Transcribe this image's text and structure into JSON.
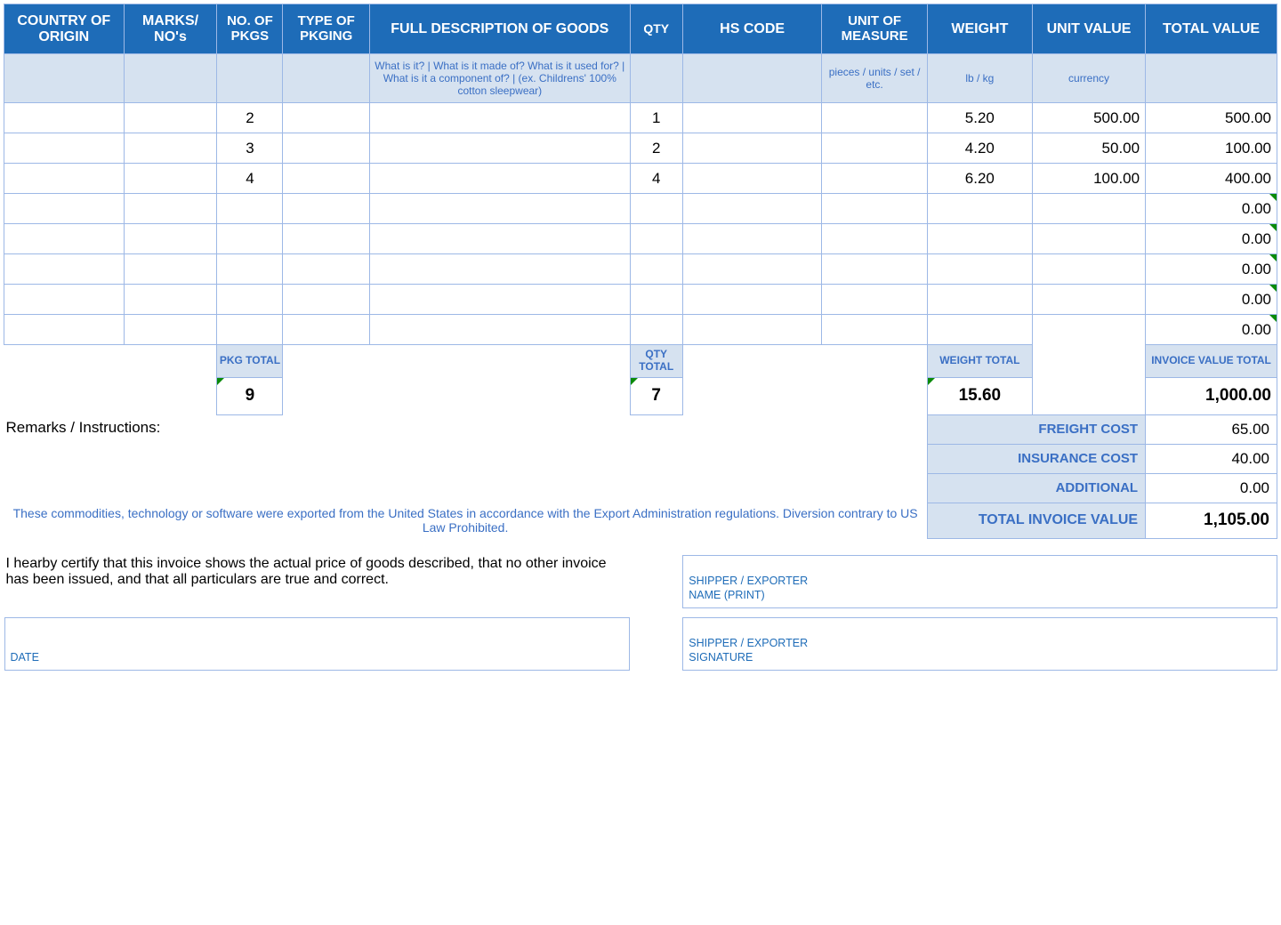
{
  "headers": {
    "country": "COUNTRY OF ORIGIN",
    "marks": "MARKS/ NO's",
    "pkgs": "NO. OF PKGS",
    "pkging": "TYPE OF PKGING",
    "desc": "FULL DESCRIPTION OF GOODS",
    "qty": "QTY",
    "hs": "HS CODE",
    "uom": "UNIT OF MEASURE",
    "weight": "WEIGHT",
    "unitval": "UNIT VALUE",
    "totval": "TOTAL VALUE"
  },
  "hints": {
    "desc": "What is it? | What is it made of? What is it used for? | What is it a component of? | (ex. Childrens' 100% cotton sleepwear)",
    "uom": "pieces / units / set / etc.",
    "weight": "lb / kg",
    "unitval": "currency"
  },
  "rows": [
    {
      "pkgs": "2",
      "qty": "1",
      "weight": "5.20",
      "unitval": "500.00",
      "totval": "500.00"
    },
    {
      "pkgs": "3",
      "qty": "2",
      "weight": "4.20",
      "unitval": "50.00",
      "totval": "100.00"
    },
    {
      "pkgs": "4",
      "qty": "4",
      "weight": "6.20",
      "unitval": "100.00",
      "totval": "400.00"
    },
    {
      "totval": "0.00"
    },
    {
      "totval": "0.00"
    },
    {
      "totval": "0.00"
    },
    {
      "totval": "0.00"
    },
    {
      "totval": "0.00"
    }
  ],
  "totals_labels": {
    "pkg": "PKG TOTAL",
    "qty": "QTY TOTAL",
    "weight": "WEIGHT TOTAL",
    "invoice": "INVOICE VALUE TOTAL"
  },
  "totals": {
    "pkg": "9",
    "qty": "7",
    "weight": "15.60",
    "invoice": "1,000.00"
  },
  "remarks_label": "Remarks / Instructions:",
  "costs": {
    "freight_label": "FREIGHT COST",
    "freight": "65.00",
    "insurance_label": "INSURANCE COST",
    "insurance": "40.00",
    "additional_label": "ADDITIONAL",
    "additional": "0.00",
    "total_label": "TOTAL INVOICE VALUE",
    "total": "1,105.00"
  },
  "footnote": "These commodities, technology or software were exported from the United States in accordance with the Export Administration regulations.  Diversion contrary to US Law Prohibited.",
  "cert": "I hearby certify that this invoice shows the actual price of goods described, that no other invoice has been issued, and that all particulars are true and correct.",
  "sig": {
    "name": "SHIPPER / EXPORTER\nNAME (PRINT)",
    "date": "DATE",
    "signature": "SHIPPER / EXPORTER\nSIGNATURE"
  }
}
